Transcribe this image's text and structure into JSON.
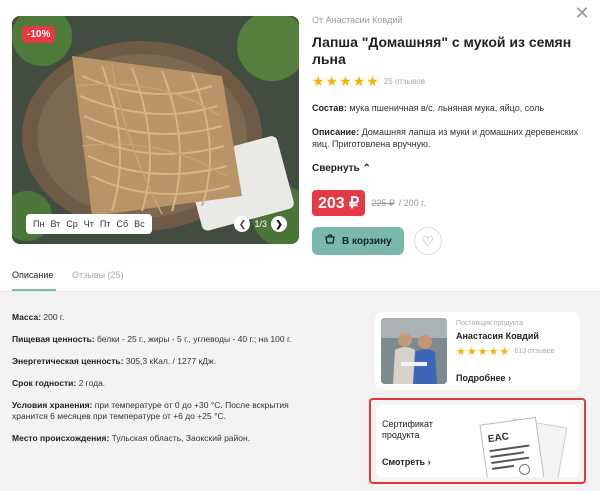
{
  "product": {
    "discount": "-10%",
    "from": "От Анастасии Ковдий",
    "title": "Лапша \"Домашняя\" с мукой из семян льна",
    "stars": "★★★★★",
    "reviews": "25 отзывов",
    "composition_label": "Состав:",
    "composition": " мука пшеничная в/с, льняная мука, яйцо, соль",
    "description_label": "Описание:",
    "description": " Домашняя лапша из муки и домашних деревенских яиц. Приготовлена вручную.",
    "collapse": "Свернуть",
    "price": "203 ₽",
    "old_price": "225 ₽",
    "weight": "/ 200 г.",
    "cart": "В корзину",
    "days": [
      "Пн",
      "Вт",
      "Ср",
      "Чт",
      "Пт",
      "Сб",
      "Вс"
    ],
    "pager": "1/3"
  },
  "tabs": {
    "description": "Описание",
    "reviews": "Отзывы (25)"
  },
  "specs": [
    {
      "label": "Масса:",
      "value": " 200 г."
    },
    {
      "label": "Пищевая ценность:",
      "value": " белки - 25 г., жиры - 5 г., углеводы - 40 г.; на 100 г."
    },
    {
      "label": "Энергетическая ценность:",
      "value": " 305,3 кКал. / 1277 кДж."
    },
    {
      "label": "Срок годности:",
      "value": " 2 года."
    },
    {
      "label": "Условия хранения:",
      "value": " при температуре от 0 до +30 °С. После вскрытия хранится 6 месяцев при температуре от +6 до +25 °С."
    },
    {
      "label": "Место происхождения:",
      "value": " Тульская область, Заокский район."
    }
  ],
  "supplier": {
    "label": "Поставщик продукта",
    "name": "Анастасия Ковдий",
    "stars": "★★★★★",
    "reviews": "613 отзывов",
    "more": "Подробнее"
  },
  "certificate": {
    "title": "Сертификат продукта",
    "link": "Смотреть",
    "mark": "EAC"
  },
  "colors": {
    "accent": "#7ab8ac",
    "sale": "#e63946",
    "highlight_border": "#e23a3a",
    "star": "#f5b400"
  }
}
